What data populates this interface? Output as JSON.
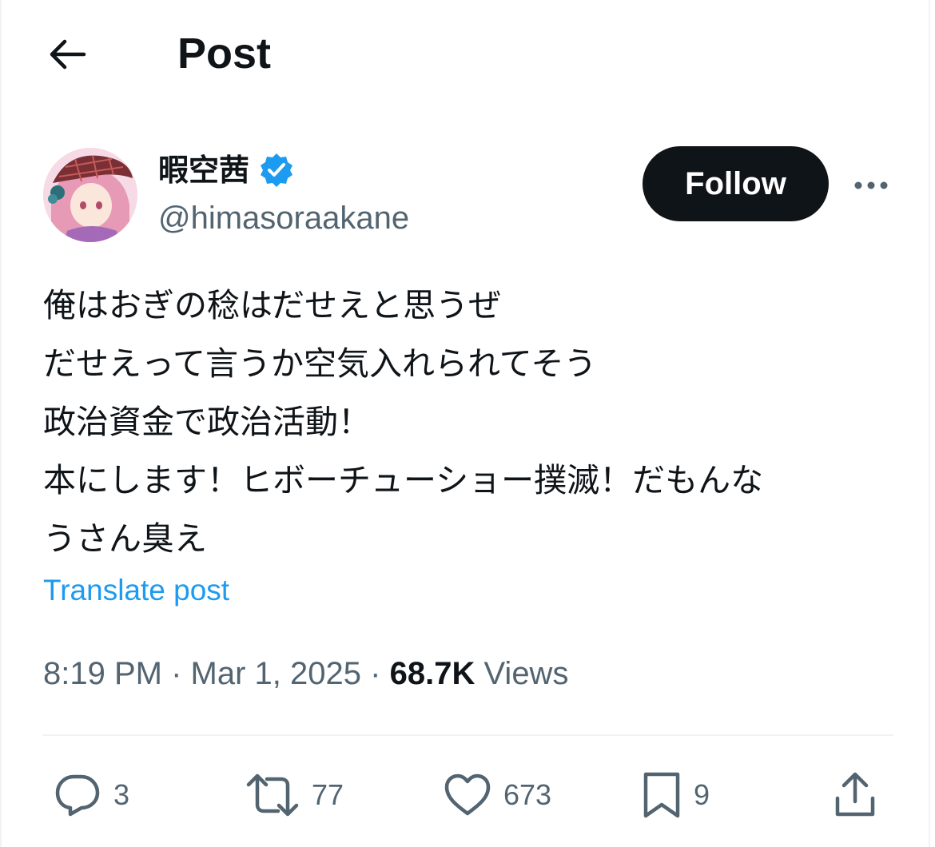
{
  "header": {
    "back_icon": "arrow-left-icon",
    "title": "Post"
  },
  "author": {
    "display_name": "暇空茜",
    "verified_icon": "verified-badge-icon",
    "handle": "@himasoraakane",
    "follow_label": "Follow",
    "more_icon": "more-horizontal-icon"
  },
  "post": {
    "lines": [
      "俺はおぎの稔はだせえと思うぜ",
      "だせえって言うか空気入れられてそう",
      "政治資金で政治活動！",
      "本にします！ヒボーチューショー撲滅！だもんな",
      "うさん臭え"
    ],
    "translate_label": "Translate post"
  },
  "meta": {
    "time": "8:19 PM",
    "separator": "·",
    "date": "Mar 1, 2025",
    "views_count": "68.7K",
    "views_label": "Views"
  },
  "actions": {
    "replies": "3",
    "reposts": "77",
    "likes": "673",
    "bookmarks": "9"
  },
  "colors": {
    "text_primary": "#0f1419",
    "text_secondary": "#536471",
    "accent": "#1d9bf0",
    "follow_bg": "#0f1419",
    "divider": "#eff3f4"
  }
}
